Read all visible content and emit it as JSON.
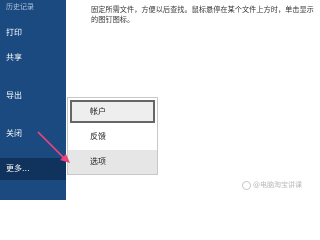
{
  "sidebar": {
    "top_item": "历史记录",
    "print": "打印",
    "share": "共享",
    "export": "导出",
    "close": "关闭",
    "more": "更多..."
  },
  "main": {
    "description": "固定所需文件，方便以后查找。鼠标悬停在某个文件上方时，单击显示的图钉图标。"
  },
  "menu": {
    "account": "帐户",
    "feedback": "反馈",
    "options": "选项"
  },
  "watermark": {
    "text": "@电脑淘宝讲课"
  },
  "colors": {
    "sidebar_bg": "#1a4a80",
    "selected_bg": "#10335d",
    "arrow": "#e8457a"
  }
}
